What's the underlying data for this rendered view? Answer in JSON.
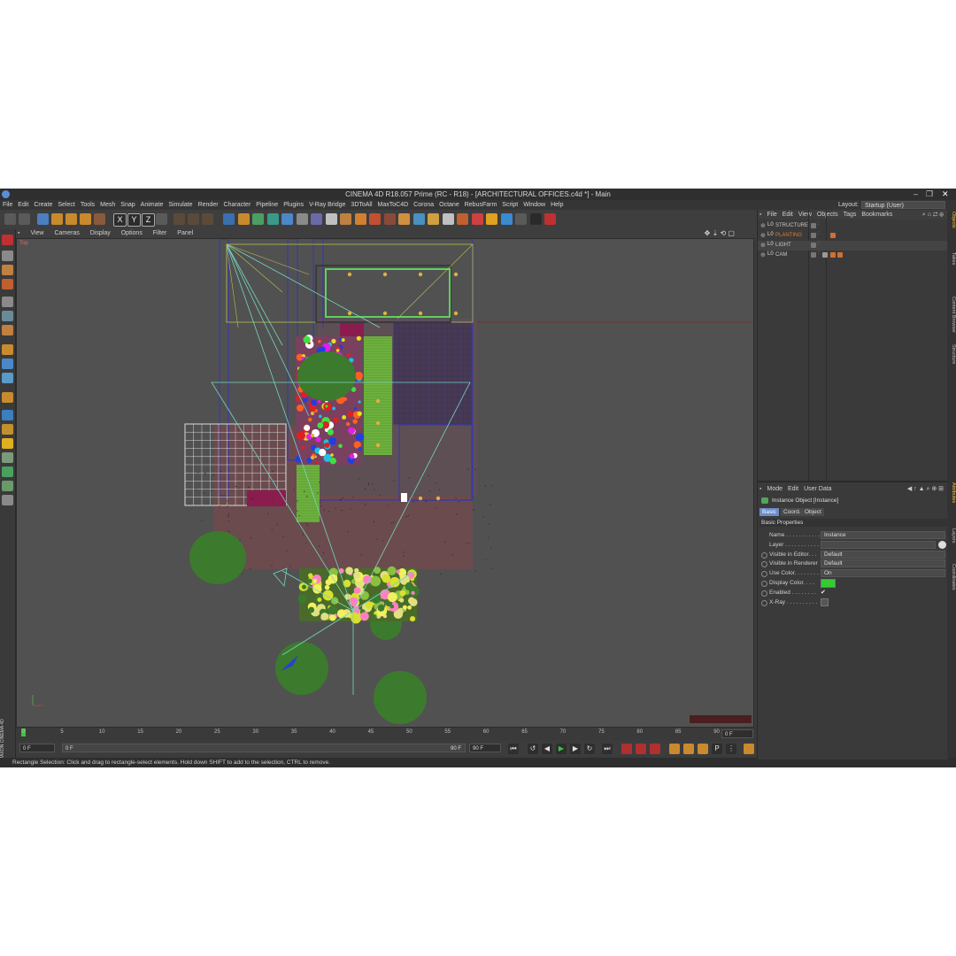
{
  "window": {
    "title": "CINEMA 4D R18.057 Prime (RC - R18) - [ARCHITECTURAL OFFICES.c4d *] - Main"
  },
  "menubar": [
    "File",
    "Edit",
    "Create",
    "Select",
    "Tools",
    "Mesh",
    "Snap",
    "Animate",
    "Simulate",
    "Render",
    "Character",
    "Pipeline",
    "Plugins",
    "V-Ray Bridge",
    "3DToAll",
    "MaxToC4D",
    "Corona",
    "Octane",
    "RebusFarm",
    "Script",
    "Window",
    "Help"
  ],
  "layout": {
    "label": "Layout:",
    "value": "Startup (User)"
  },
  "toolbar_axes": [
    "X",
    "Y",
    "Z"
  ],
  "viewport": {
    "menu": [
      "View",
      "Cameras",
      "Display",
      "Options",
      "Filter",
      "Panel"
    ],
    "label": "Top"
  },
  "timeline": {
    "ticks": [
      "0",
      "5",
      "10",
      "15",
      "20",
      "25",
      "30",
      "35",
      "40",
      "45",
      "50",
      "55",
      "60",
      "65",
      "70",
      "75",
      "80",
      "85",
      "90"
    ],
    "current_frame": "0 F",
    "start": "0 F",
    "start_inner": "0 F",
    "end_inner": "90 F",
    "end": "90 F"
  },
  "status": "Rectangle Selection: Click and drag to rectangle-select elements. Hold down SHIFT to add to the selection, CTRL to remove.",
  "object_manager": {
    "menu": [
      "File",
      "Edit",
      "View",
      "Objects",
      "Tags",
      "Bookmarks"
    ],
    "objects": [
      {
        "name": "STRUCTURE",
        "color": "#c8c8c8"
      },
      {
        "name": "PLANTING",
        "color": "#e07a2e"
      },
      {
        "name": "LIGHT",
        "color": "#c8c8c8"
      },
      {
        "name": "CAM",
        "color": "#c8c8c8"
      }
    ]
  },
  "attributes": {
    "menu": [
      "Mode",
      "Edit",
      "User Data"
    ],
    "object_title": "Instance Object [Instance]",
    "tabs": [
      "Basic",
      "Coord.",
      "Object"
    ],
    "section": "Basic Properties",
    "fields": [
      {
        "label": "Name . . . . . . . . . . .",
        "value": "Instance"
      },
      {
        "label": "Layer . . . . . . . . . . .",
        "value": ""
      },
      {
        "label": "Visible in Editor. . .",
        "value": "Default"
      },
      {
        "label": "Visible in Renderer",
        "value": "Default"
      },
      {
        "label": "Use Color. . . . . . . .",
        "value": "On"
      },
      {
        "label": "Display Color. . . .",
        "value": ""
      },
      {
        "label": "Enabled . . . . . . . .",
        "value": "✔"
      },
      {
        "label": "X-Ray . . . . . . . . . .",
        "value": ""
      }
    ],
    "display_color": "#33cc33"
  },
  "side_tabs": [
    "Objects",
    "Takes",
    "Content Browser",
    "Structure",
    "Attributes",
    "Layers",
    "Coordinates"
  ],
  "branding": "MAXON CINEMA 4D"
}
